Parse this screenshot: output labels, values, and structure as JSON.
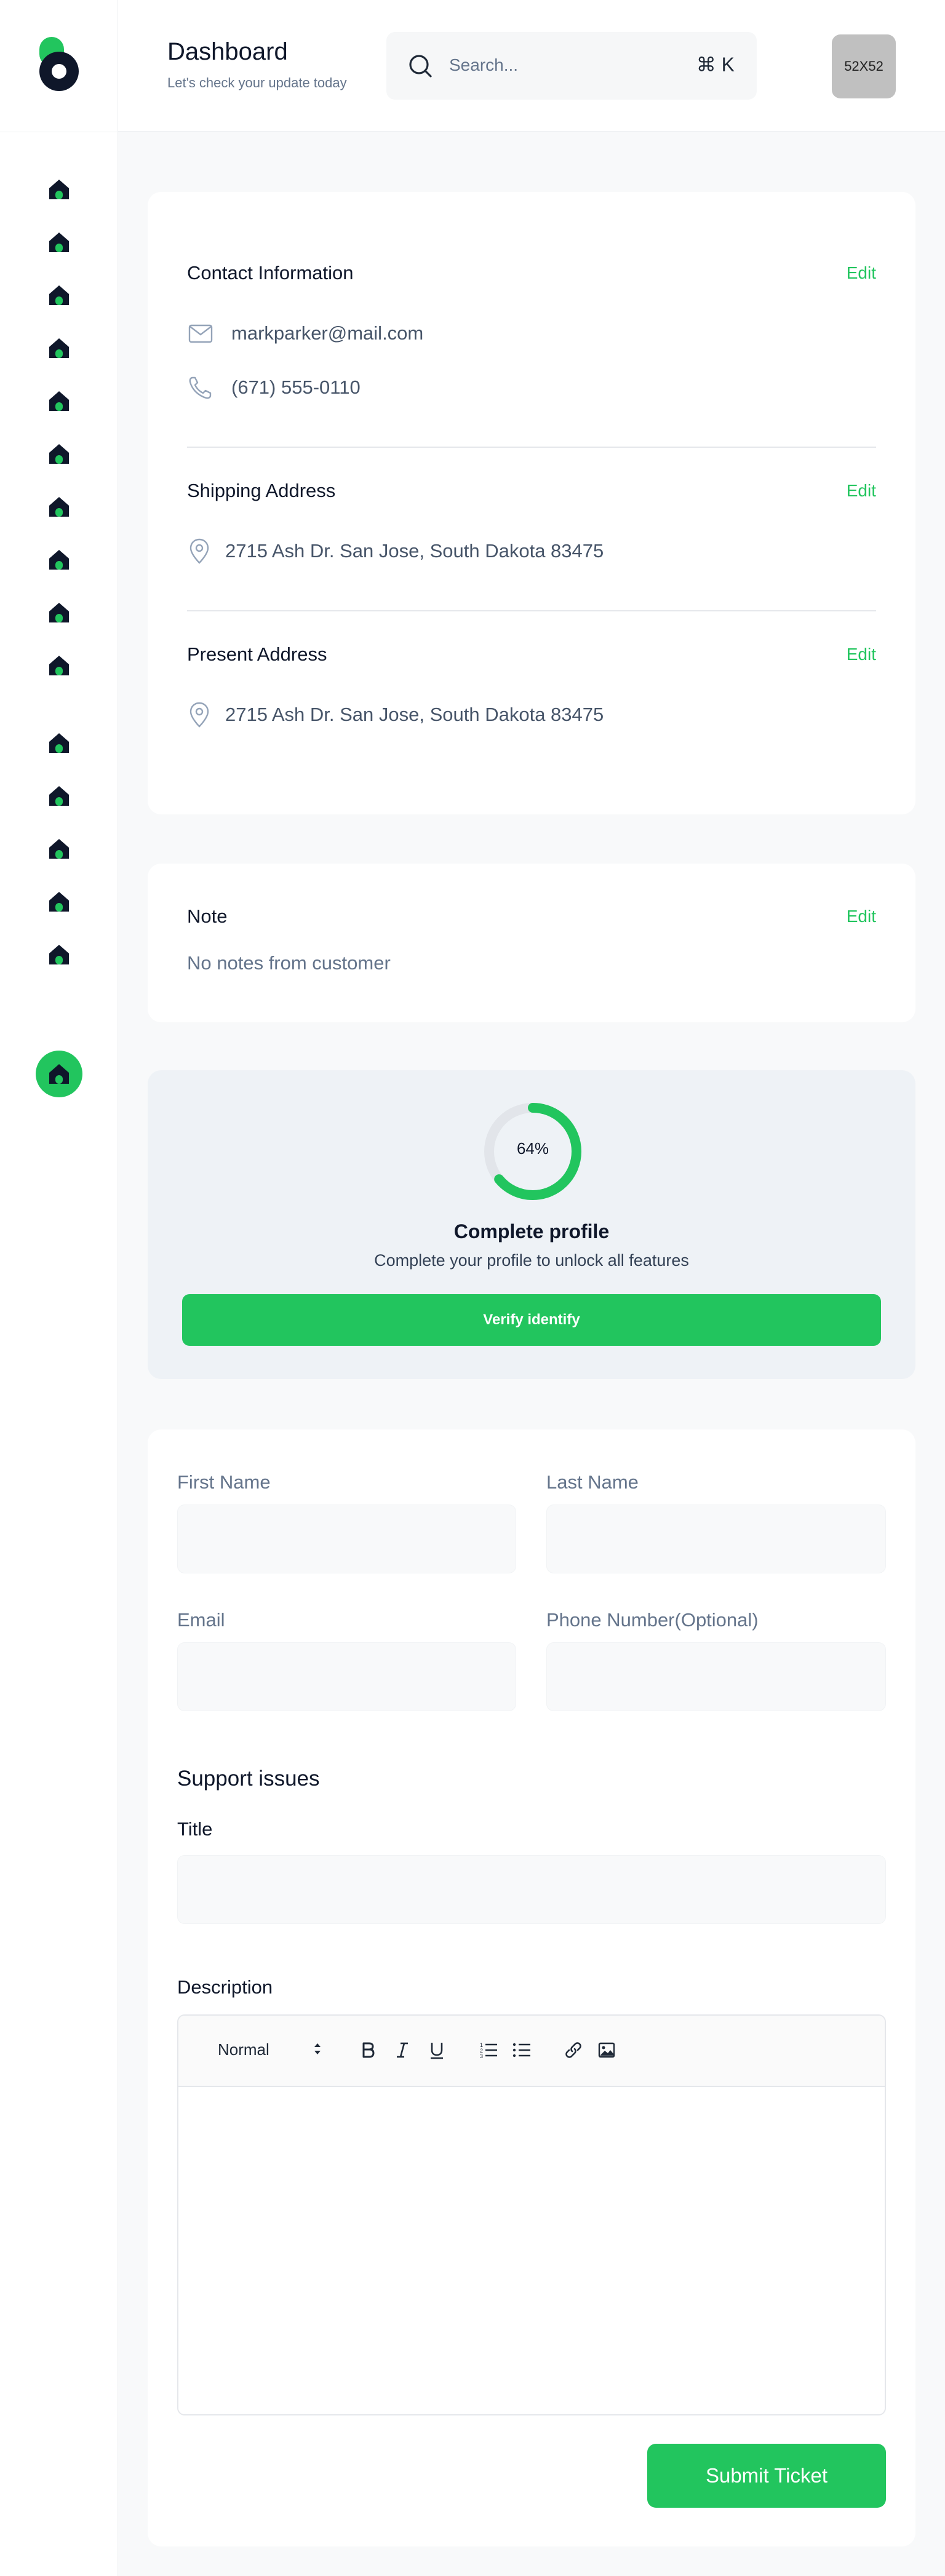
{
  "header": {
    "title": "Dashboard",
    "subtitle": "Let's check your update today",
    "search": {
      "placeholder": "Search...",
      "shortcut": "⌘ K"
    },
    "avatar_label": "52X52"
  },
  "sidebar": {
    "items": [
      {
        "icon": "home-icon"
      },
      {
        "icon": "home-icon"
      },
      {
        "icon": "home-icon"
      },
      {
        "icon": "home-icon"
      },
      {
        "icon": "home-icon"
      },
      {
        "icon": "home-icon"
      },
      {
        "icon": "home-icon"
      },
      {
        "icon": "home-icon"
      },
      {
        "icon": "home-icon"
      },
      {
        "icon": "home-icon"
      },
      {
        "icon": "home-icon"
      },
      {
        "icon": "home-icon"
      },
      {
        "icon": "home-icon"
      },
      {
        "icon": "home-icon"
      },
      {
        "icon": "home-icon"
      }
    ],
    "active_item": {
      "icon": "home-icon"
    }
  },
  "colors": {
    "accent": "#22c55e",
    "dark": "#0f172a",
    "muted": "#64748b"
  },
  "contact": {
    "title": "Contact Information",
    "edit_label": "Edit",
    "email": "markparker@mail.com",
    "phone": "(671) 555-0110"
  },
  "shipping": {
    "title": "Shipping Address",
    "edit_label": "Edit",
    "address": "2715 Ash Dr. San Jose, South Dakota 83475"
  },
  "present": {
    "title": "Present Address",
    "edit_label": "Edit",
    "address": "2715 Ash Dr. San Jose, South Dakota 83475"
  },
  "note": {
    "title": "Note",
    "edit_label": "Edit",
    "text": "No notes from customer"
  },
  "profile": {
    "progress": 64,
    "progress_label": "64%",
    "title": "Complete profile",
    "description": "Complete your profile to unlock all features",
    "button_label": "Verify identify"
  },
  "form": {
    "first_name_label": "First Name",
    "last_name_label": "Last Name",
    "email_label": "Email",
    "phone_label": "Phone Number(Optional)",
    "support_heading": "Support issues",
    "title_label": "Title",
    "description_label": "Description",
    "editor": {
      "format_value": "Normal",
      "tools": [
        "bold-icon",
        "italic-icon",
        "underline-icon",
        "ordered-list-icon",
        "bullet-list-icon",
        "link-icon",
        "image-icon"
      ]
    },
    "submit_label": "Submit Ticket"
  }
}
